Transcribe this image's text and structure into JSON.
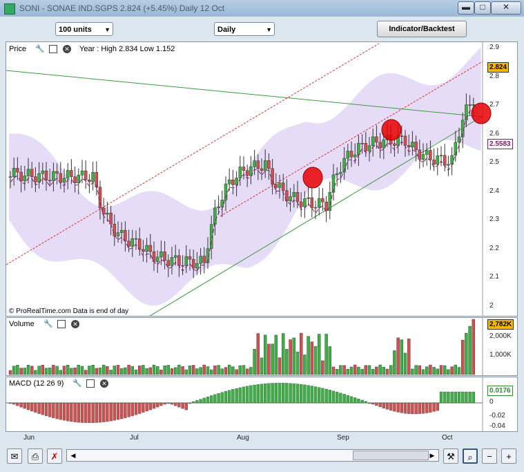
{
  "window": {
    "title": "SONI - SONAE IND.SGPS    2.824 (+5.45%)    Daily  12 Oct",
    "minimize": "▬",
    "maximize": "□",
    "close": "✕"
  },
  "toolbar": {
    "units_value": "100 units",
    "period_value": "Daily",
    "indicator_button": "Indicator/Backtest"
  },
  "price_panel": {
    "label": "Price",
    "info": "Year : High 2.834 Low 1.152",
    "copyright": "© ProRealTime.com  Data is end of day",
    "y_ticks": [
      "2.9",
      "2.8",
      "2.7",
      "2.6",
      "2.5",
      "2.4",
      "2.3",
      "2.2",
      "2.1",
      "2"
    ],
    "last_price": "2.824",
    "ma_value": "2.5583"
  },
  "volume_panel": {
    "label": "Volume",
    "y_ticks": [
      "2,000K",
      "1,000K"
    ],
    "last_value": "2,782K"
  },
  "macd_panel": {
    "label": "MACD (12 26 9)",
    "y_ticks": [
      "0",
      "-0.02",
      "-0.04"
    ],
    "last_value": "0.0176"
  },
  "x_axis": {
    "months": [
      "Jun",
      "Jul",
      "Aug",
      "Sep",
      "Oct"
    ]
  },
  "colors": {
    "up": "#3cb043",
    "down": "#d05050",
    "cloud": "#e6dcf8",
    "trend_green": "#3a9a3a",
    "trend_red": "#e03030",
    "ma": "#8a1a6a"
  },
  "bottom": {
    "icons": [
      "mail-icon",
      "print-icon",
      "cursor-icon",
      "chart-tool-icon",
      "zoom-fit-icon",
      "zoom-out-icon",
      "zoom-in-icon"
    ]
  }
}
